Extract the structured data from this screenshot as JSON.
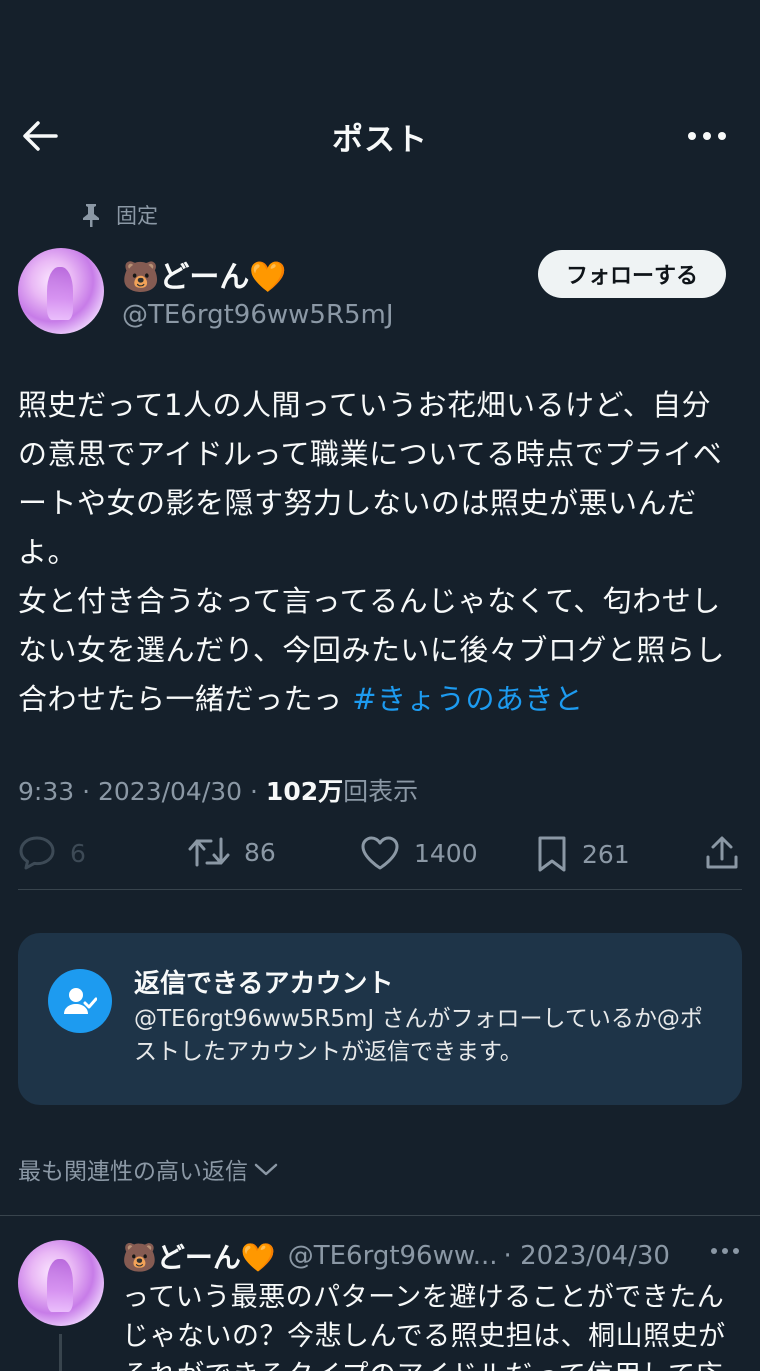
{
  "header": {
    "title": "ポスト",
    "back_icon": "arrow-left-icon",
    "more_icon": "more-horizontal-icon"
  },
  "pinned": {
    "label": "固定"
  },
  "author": {
    "display_name": "🐻どーん🧡",
    "handle": "@TE6rgt96ww5R5mJ"
  },
  "follow_button": "フォローする",
  "post": {
    "text": "照史だって1人の人間っていうお花畑いるけど、自分の意思でアイドルって職業についてる時点でプライベートや女の影を隠す努力しないのは照史が悪いんだよ。\n女と付き合うなって言ってるんじゃなくて、匂わせしない女を選んだり、今回みたいに後々ブログと照らし合わせたら一緒だったっ ",
    "hashtag": "#きょうのあきと"
  },
  "meta": {
    "time": "9:33",
    "date": "2023/04/30",
    "views_count": "102万",
    "views_label": "回表示",
    "sep": " · "
  },
  "actions": {
    "replies": "6",
    "reposts": "86",
    "likes": "1400",
    "bookmarks": "261"
  },
  "reply_restriction": {
    "title": "返信できるアカウント",
    "description": "@TE6rgt96ww5R5mJ さんがフォローしているか@ポストしたアカウントが返信できます。"
  },
  "sort": {
    "label": "最も関連性の高い返信"
  },
  "reply": {
    "display_name": "🐻どーん🧡",
    "handle": "@TE6rgt96ww...",
    "date": "· 2023/04/30",
    "text": "っていう最悪のパターンを避けることができたんじゃないの？今悲しんでる照史担は、桐山照史がそれができるタイプのアイドルだって信用して応"
  }
}
